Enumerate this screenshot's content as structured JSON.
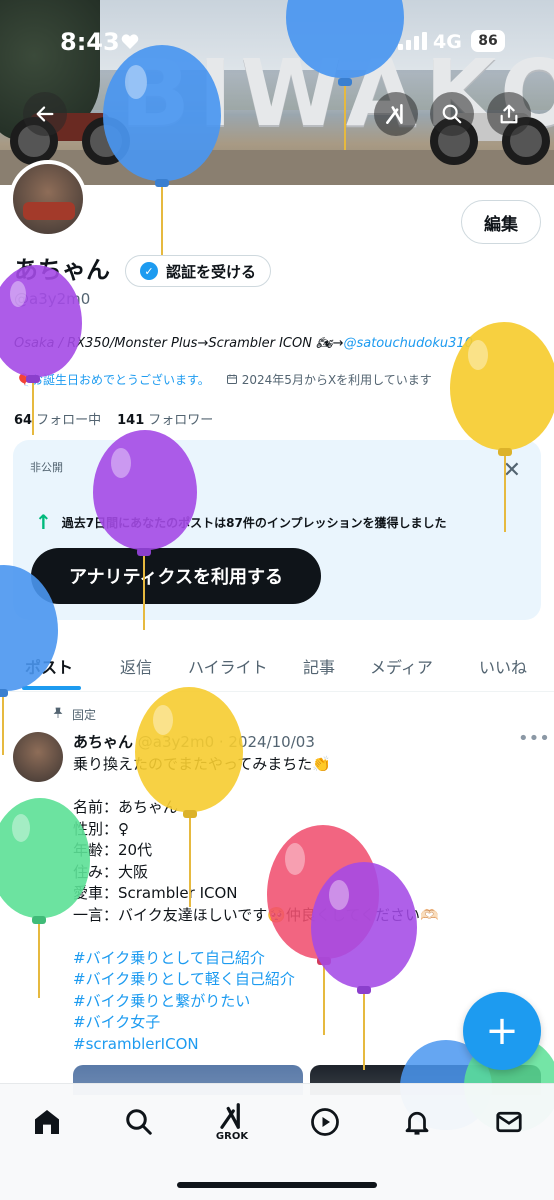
{
  "status_bar": {
    "time": "8:43",
    "network": "4G",
    "battery": "86"
  },
  "banner": {
    "sign_text": "BIWAKO"
  },
  "profile": {
    "edit_label": "編集",
    "name": "あちゃん",
    "verify_label": "認証を受ける",
    "handle": "@a3y2m0",
    "bio_text": "Osaka / RX350/Monster Plus→Scrambler ICON 🏍→",
    "bio_mention": "@satouchudoku310",
    "birthday": "お誕生日おめでとうございます。",
    "joined": "2024年5月からXを利用しています",
    "following_count": "64",
    "following_label": "フォロー中",
    "followers_count": "141",
    "followers_label": "フォロワー"
  },
  "analytics_card": {
    "tag": "非公開",
    "stat": "過去7日間にあなたのポストは87件のインプレッションを獲得しました",
    "cta": "アナリティクスを利用する"
  },
  "tabs": [
    "ポスト",
    "返信",
    "ハイライト",
    "記事",
    "メディア",
    "いいね"
  ],
  "pinned_post": {
    "pinned_label": "固定",
    "author": "あちゃん",
    "handle_date": "@a3y2m0 · 2024/10/03",
    "line1": "乗り換えたのでまたやってみまちた👏",
    "lines": [
      "名前：あちゃん",
      "性別：♀",
      "年齢：20代",
      "住み：大阪",
      "愛車：Scrambler ICON",
      "一言：バイク友達ほしいです🥺仲良くしてください🫶🏻"
    ],
    "hashtags": [
      "#バイク乗りとして自己紹介",
      "#バイク乗りとして軽く自己紹介",
      "#バイク乗りと繋がりたい",
      "#バイク女子",
      "#scramblerICON"
    ]
  },
  "bottom_nav": {
    "grok_label": "GROK"
  },
  "colors": {
    "accent": "#1d9bf0",
    "text": "#0f1419",
    "muted": "#536471"
  }
}
